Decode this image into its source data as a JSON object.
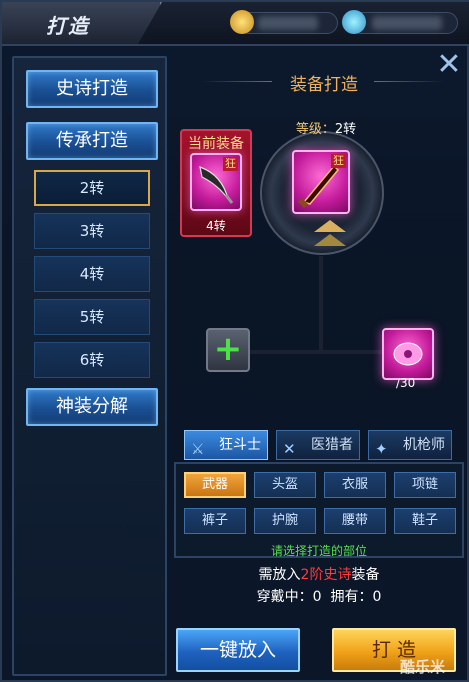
{
  "window": {
    "title": "打造",
    "close_icon": "close-icon"
  },
  "topbar": {
    "resources": [
      "gold-coin-icon",
      "diamond-icon"
    ]
  },
  "sidebar": {
    "main_buttons": [
      "史诗打造",
      "传承打造"
    ],
    "sub_items": [
      "2转",
      "3转",
      "4转",
      "5转",
      "6转"
    ],
    "active_sub": "2转",
    "bottom_button": "神装分解"
  },
  "forge": {
    "section_title": "装备打造",
    "level_label": "等级：",
    "level_value": "2转",
    "target_tag": "狂",
    "current_equip": {
      "label": "当前装备",
      "tag": "狂",
      "tier": "4转"
    },
    "material_count": "/30",
    "add_icon": "plus-icon"
  },
  "classes": [
    {
      "name": "狂斗士",
      "icon": "sword-icon",
      "active": true
    },
    {
      "name": "医猎者",
      "icon": "crossbow-icon",
      "active": false
    },
    {
      "name": "机枪师",
      "icon": "gun-icon",
      "active": false
    }
  ],
  "parts": {
    "row1": [
      "武器",
      "头盔",
      "衣服",
      "项链"
    ],
    "row2": [
      "裤子",
      "护腕",
      "腰带",
      "鞋子"
    ],
    "active": "武器",
    "hint": "请选择打造的部位"
  },
  "requirement": {
    "prefix": "需放入",
    "highlight": "2阶史诗",
    "suffix": "装备",
    "wearing_label": "穿戴中：",
    "wearing_value": "0",
    "owned_label": "拥有：",
    "owned_value": "0"
  },
  "actions": {
    "one_click": "一键放入",
    "forge": "打 造"
  },
  "watermark": "酷乐米",
  "colors": {
    "accent_gold": "#f0b25a",
    "hint_green": "#55e04f",
    "warn_red": "#ff3b3b"
  }
}
